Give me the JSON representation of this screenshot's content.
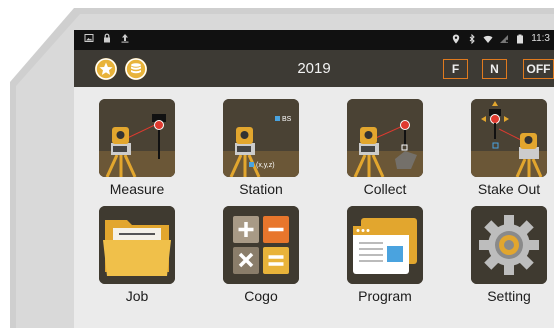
{
  "statusbar": {
    "time": "11:3"
  },
  "appbar": {
    "title": "2019",
    "buttons": [
      "F",
      "N",
      "OFF"
    ]
  },
  "apps": [
    {
      "label": "Measure"
    },
    {
      "label": "Station",
      "tag_bs": "BS",
      "tag_xyz": "(x,y,z)"
    },
    {
      "label": "Collect"
    },
    {
      "label": "Stake Out"
    },
    {
      "label": "Job"
    },
    {
      "label": "Cogo"
    },
    {
      "label": "Program"
    },
    {
      "label": "Setting"
    }
  ]
}
